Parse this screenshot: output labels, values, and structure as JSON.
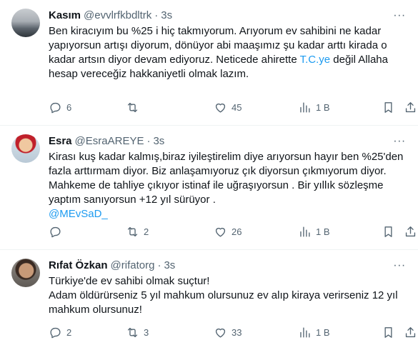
{
  "tweets": [
    {
      "name": "Kasım",
      "handle": "@evvlrfkbdltrk",
      "separator": "·",
      "time": "3s",
      "lines": [
        "Ben kiracıyım bu %25 i hiç takmıyorum. Arıyorum ev sahibini ne kadar",
        "yapıyorsun artışı diyorum, dönüyor abi maaşımız şu kadar arttı kirada o",
        "kadar artsın diyor devam ediyoruz. Neticede ahirette ",
        " değil Allaha",
        "hesap vereceğiz hakkaniyetli olmak lazım."
      ],
      "inline_link": "T.C.ye",
      "replies": "6",
      "retweets": "",
      "likes": "45",
      "views": "1 B"
    },
    {
      "name": "Esra",
      "handle": "@EsraAREYE",
      "separator": "·",
      "time": "3s",
      "lines": [
        "Kirası kuş kadar kalmış,biraz iyileştirelim diye arıyorsun hayır ben %25'den",
        "fazla arttırmam diyor. Biz anlaşamıyoruz çık diyorsun çıkmıyorum diyor.",
        "Mahkeme de tahliye çıkıyor istinaf ile uğraşıyorsun . Bir yıllık sözleşme",
        "yaptım sanıyorsun +12 yıl sürüyor ."
      ],
      "mention": "@MEvSaD_",
      "replies": "",
      "retweets": "2",
      "likes": "26",
      "views": "1 B"
    },
    {
      "name": "Rıfat Özkan",
      "handle": "@rifatorg",
      "separator": "·",
      "time": "3s",
      "lines": [
        "Türkiye'de ev sahibi olmak suçtur!",
        "Adam öldürürseniz 5 yıl mahkum olursunuz ev alıp kiraya verirseniz 12 yıl",
        "mahkum olursunuz!"
      ],
      "replies": "2",
      "retweets": "3",
      "likes": "33",
      "views": "1 B"
    }
  ],
  "icons": {
    "more": "more-horizontal-icon",
    "reply": "reply-bubble-icon",
    "retweet": "retweet-arrows-icon",
    "like": "heart-icon",
    "views": "bar-chart-views-icon",
    "bookmark": "bookmark-icon",
    "share": "share-upload-icon"
  },
  "colors": {
    "text": "#0f1419",
    "secondary": "#536471",
    "link": "#1d9bf0",
    "divider": "#eff3f4"
  }
}
